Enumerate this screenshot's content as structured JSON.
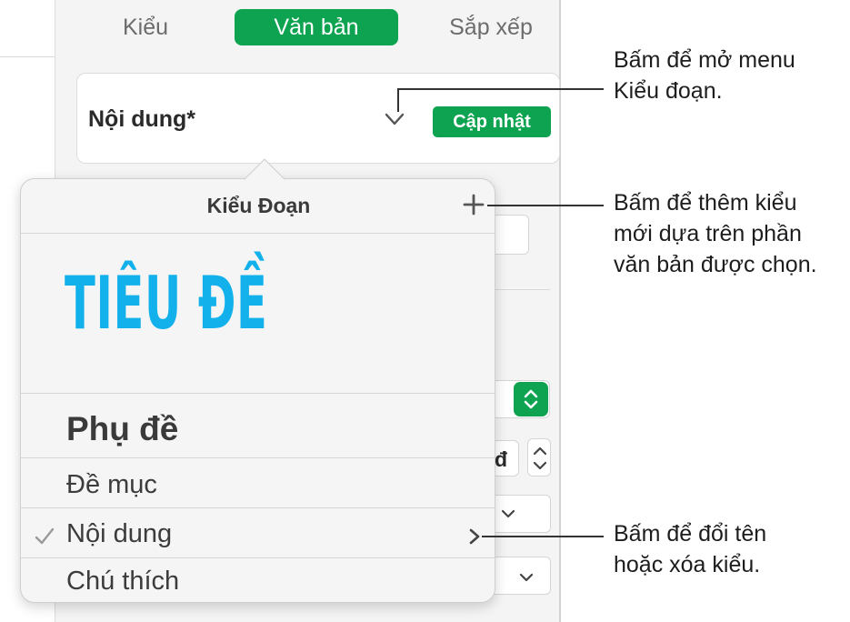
{
  "tabs": [
    {
      "label": "Kiểu"
    },
    {
      "label": "Văn bản"
    },
    {
      "label": "Sắp xếp"
    }
  ],
  "style_box": {
    "name": "Nội dung*",
    "update_label": "Cập nhật"
  },
  "popover": {
    "title": "Kiểu Đoạn",
    "items": [
      {
        "label": "TIÊU ĐỀ"
      },
      {
        "label": "Phụ đề"
      },
      {
        "label": "Đề mục"
      },
      {
        "label": "Nội dung"
      },
      {
        "label": "Chú thích"
      }
    ]
  },
  "background": {
    "partial_label": "đ"
  },
  "callouts": {
    "menu": [
      "Bấm để mở menu",
      "Kiểu đoạn."
    ],
    "add": [
      "Bấm để thêm kiểu",
      "mới dựa trên phần",
      "văn bản được chọn."
    ],
    "rename": [
      "Bấm để đổi tên",
      "hoặc xóa kiểu."
    ]
  },
  "colors": {
    "accent_green": "#0ea350",
    "title_blue": "#12b1eb"
  }
}
